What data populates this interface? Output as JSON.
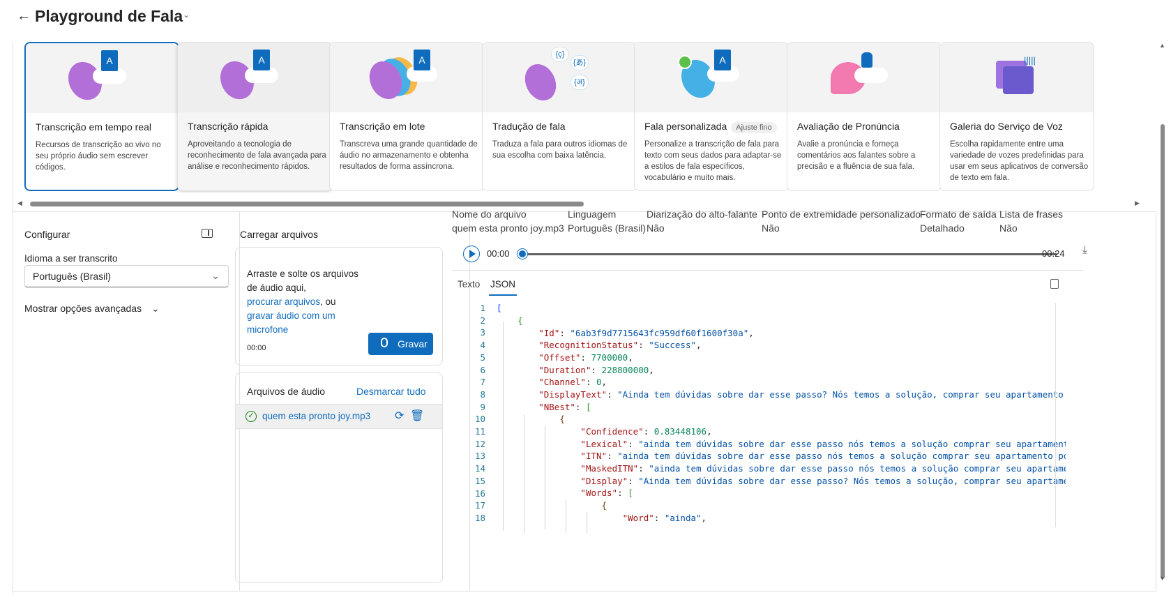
{
  "header": {
    "back": "←",
    "title": "Playground de Fala",
    "caret": "⌄"
  },
  "cards": [
    {
      "title": "Transcrição em tempo real",
      "desc": "Recursos de transcrição ao vivo no seu próprio áudio sem escrever códigos."
    },
    {
      "title": "Transcrição rápida",
      "desc": "Aproveitando a tecnologia de reconhecimento de fala avançada para análise e reconhecimento rápidos."
    },
    {
      "title": "Transcrição em lote",
      "desc": "Transcreva uma grande quantidade de áudio no armazenamento e obtenha resultados de forma assíncrona."
    },
    {
      "title": "Tradução de fala",
      "desc": "Traduza a fala para outros idiomas de sua escolha com baixa latência."
    },
    {
      "title": "Fala personalizada",
      "badge": "Ajuste fino",
      "desc": "Personalize a transcrição de fala para texto com seus dados para adaptar-se a estilos de fala específicos, vocabulário e muito mais."
    },
    {
      "title": "Avaliação de Pronúncia",
      "desc": "Avalie a pronúncia e forneça comentários aos falantes sobre a precisão e a fluência de sua fala."
    },
    {
      "title": "Galeria do Serviço de Voz",
      "desc": "Escolha rapidamente entre uma variedade de vozes predefinidas para usar em seus aplicativos de conversão de texto em fala."
    }
  ],
  "configure": {
    "title": "Configurar",
    "lang_label": "Idioma a ser transcrito",
    "lang_value": "Português (Brasil)",
    "advanced": "Mostrar opções avançadas"
  },
  "upload": {
    "title": "Carregar arquivos",
    "drop_l1": "Arraste e solte os arquivos",
    "drop_l2": "de áudio aqui,",
    "browse": "procurar arquivos",
    "or": ", ou",
    "record_link": "gravar áudio com um microfone",
    "time": "00:00",
    "record_btn": "Gravar",
    "files_title": "Arquivos de áudio",
    "deselect": "Desmarcar tudo",
    "file": "quem esta pronto joy.mp3"
  },
  "results": {
    "meta": [
      {
        "label": "Nome do arquivo",
        "value": "quem esta pronto joy.mp3"
      },
      {
        "label": "Linguagem",
        "value": "Português (Brasil)"
      },
      {
        "label": "Diarização do alto-falante",
        "value": "Não"
      },
      {
        "label": "Ponto de extremidade personalizado",
        "value": "Não"
      },
      {
        "label": "Formato de saída",
        "value": "Detalhado"
      },
      {
        "label": "Lista de frases",
        "value": "Não"
      }
    ],
    "player": {
      "start": "00:00",
      "end": "00:24",
      "progress": 0
    },
    "tabs": [
      "Texto",
      "JSON"
    ],
    "active_tab": "JSON"
  },
  "json_lines": [
    "1",
    "2",
    "3",
    "4",
    "5",
    "6",
    "7",
    "8",
    "9",
    "10",
    "11",
    "12",
    "13",
    "14",
    "15",
    "16",
    "17",
    "18"
  ],
  "json_code": {
    "id": "\"6ab3f9d7715643fc959df60f1600f30a\"",
    "status": "\"Success\"",
    "offset": "7700000",
    "duration": "228800000",
    "channel": "0",
    "display_text": "\"Ainda tem dúvidas sobre dar esse passo? Nós temos a solução, comprar seu apartamento p",
    "confidence": "0.83448106",
    "lexical": "\"ainda tem dúvidas sobre dar esse passo nós temos a solução comprar seu apartamento",
    "itn": "\"ainda tem dúvidas sobre dar esse passo nós temos a solução comprar seu apartamento po",
    "masked": "\"ainda tem dúvidas sobre dar esse passo nós temos a solução comprar seu apartamen",
    "display": "\"Ainda tem dúvidas sobre dar esse passo? Nós temos a solução, comprar seu apartamen",
    "word": "\"ainda\""
  }
}
